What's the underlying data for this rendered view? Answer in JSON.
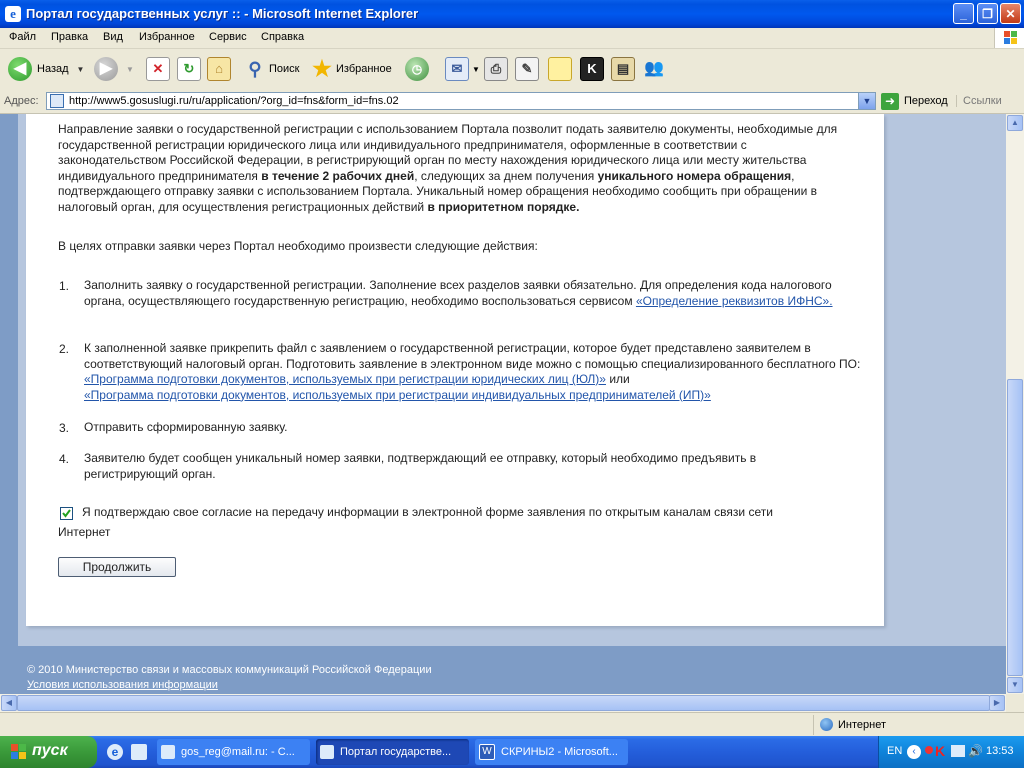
{
  "window": {
    "title": "Портал государственных услуг :: - Microsoft Internet Explorer"
  },
  "menu": [
    "Файл",
    "Правка",
    "Вид",
    "Избранное",
    "Сервис",
    "Справка"
  ],
  "toolbar": {
    "back_label": "Назад",
    "search_label": "Поиск",
    "favorites_label": "Избранное"
  },
  "address": {
    "label": "Адрес:",
    "url": "http://www5.gosuslugi.ru/ru/application/?org_id=fns&form_id=fns.02",
    "go_label": "Переход",
    "links_label": "Ссылки"
  },
  "content": {
    "intro_1": "Направление заявки о государственной регистрации  с использованием Портала позволит подать заявителю документы, необходимые для государственной регистрации юридического лица или индивидуального предпринимателя, оформленные в соответствии с законодательством Российской Федерации, в регистрирующий орган по месту нахождения юридического лица или месту жительства индивидуального предпринимателя ",
    "intro_bold_1": "в течение 2 рабочих дней",
    "intro_2": ", следующих за днем получения ",
    "intro_bold_2": "уникального номера обращения",
    "intro_3": ", подтверждающего отправку заявки с использованием Портала. Уникальный номер обращения необходимо сообщить при обращении в налоговый орган, для осуществления регистрационных действий ",
    "intro_bold_3": " в приоритетном порядке.",
    "steps_heading": "В целях отправки заявки через Портал необходимо произвести следующие действия:",
    "step1_num": "1.",
    "step1_text": "Заполнить заявку о государственной регистрации. Заполнение всех разделов заявки обязательно. Для определения кода налогового органа, осуществляющего государственную регистрацию, необходимо воспользоваться сервисом ",
    "step1_link": "«Определение реквизитов ИФНС».",
    "step2_num": "2.",
    "step2_text": "К заполненной заявке прикрепить файл с заявлением о государственной регистрации, которое будет представлено заявителем в соответствующий налоговый орган.  Подготовить заявление в электронном виде можно с помощью специализированного бесплатного ПО:  ",
    "step2_link1": "«Программа подготовки  документов, используемых при регистрации юридических лиц (ЮЛ)»",
    "step2_or": " или",
    "step2_link2": "«Программа подготовки  документов, используемых при регистрации индивидуальных предпринимателей (ИП)»",
    "step3_num": "3.",
    "step3_text": "Отправить сформированную заявку.",
    "step4_num": "4.",
    "step4_text": "Заявителю будет сообщен уникальный номер заявки, подтверждающий ее отправку, который необходимо предъявить в регистрирующий орган.",
    "consent_text": "Я подтверждаю свое согласие на передачу информации в электронной форме заявления по открытым каналам связи сети",
    "consent_text_2": "Интернет",
    "continue_label": "Продолжить"
  },
  "footer": {
    "copyright": "© 2010 Министерство связи и массовых коммуникаций Российской Федерации",
    "terms_link": "Условия использования информации"
  },
  "status": {
    "zone": "Интернет"
  },
  "taskbar": {
    "start_label": "пуск",
    "tasks": [
      "gos_reg@mail.ru: - С...",
      "Портал государстве...",
      "СКРИНЫ2 - Microsoft..."
    ],
    "lang": "EN",
    "clock": "13:53"
  },
  "colors": {
    "link": "#2255AA",
    "page_background": "#B6C6DE",
    "title_bar": "#0054E3"
  }
}
